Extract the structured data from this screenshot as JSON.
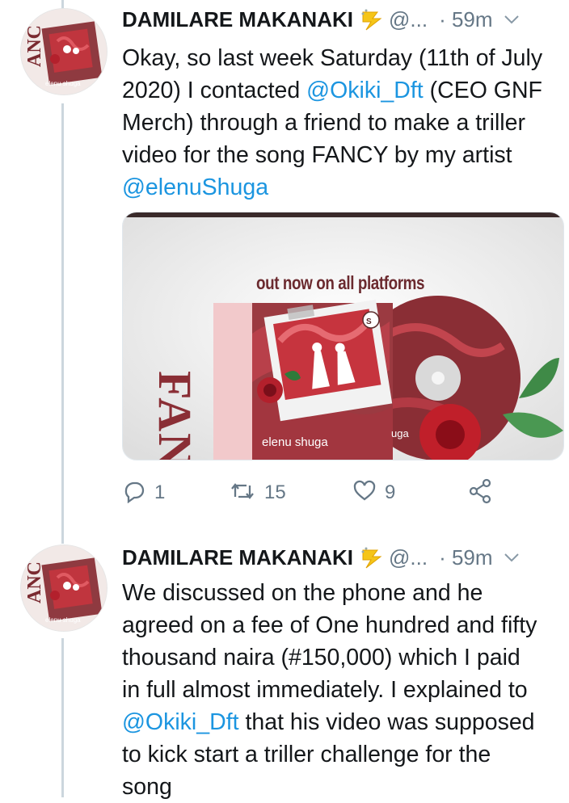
{
  "tweets": [
    {
      "author_name": "DAMILARE MAKANAKI",
      "badge_icon": "emoji-badge-icon",
      "handle": "@...",
      "time": "· 59m",
      "body_lines": [
        "Okay, so last week Saturday (11th of July",
        "2020) I contacted ",
        "@Okiki_Dft",
        " (CEO GNF",
        "Merch) through a friend to make a triller",
        "video for the song FANCY by my artist",
        "@elenuShuga"
      ],
      "media": {
        "promo_text": "out now on all platforms",
        "cover_title": "FANCY",
        "artist": "elenu shuga",
        "disc_text": "uga"
      },
      "actions": {
        "reply_count": "1",
        "retweet_count": "15",
        "like_count": "9"
      }
    },
    {
      "author_name": "DAMILARE MAKANAKI",
      "badge_icon": "emoji-badge-icon",
      "handle": "@...",
      "time": "· 59m",
      "body_lines": [
        "We discussed on the phone and he",
        "agreed on a fee of One hundred and fifty",
        "thousand naira (#150,000) which I paid",
        "in full almost immediately. I explained to",
        "@Okiki_Dft",
        " that his video was supposed",
        "to kick start a triller challenge for the",
        "song"
      ]
    }
  ],
  "colors": {
    "link": "#1b95e0",
    "muted": "#657786",
    "thread_line": "#ccd6dd",
    "cover_red": "#a0303a"
  }
}
